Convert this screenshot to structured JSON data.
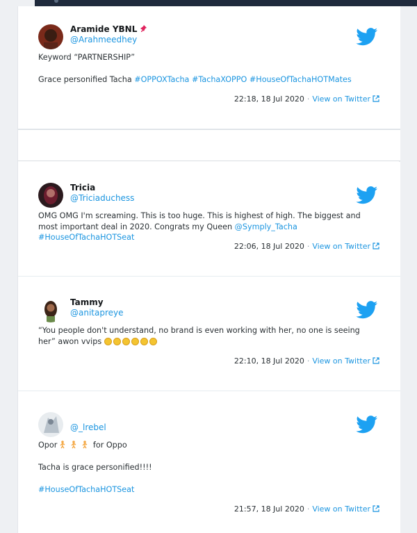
{
  "tweets": [
    {
      "name": "Aramide YBNL",
      "handle": "@Arahmeedhey",
      "line1": "Keyword “PARTNERSHIP”",
      "line2_prefix": "Grace personified Tacha ",
      "line2_tags": [
        "#OPPOXTacha",
        "#TachaXOPPO",
        "#HouseOfTachaHOTMates"
      ],
      "timestamp": "22:18, 18 Jul 2020",
      "view_label": "View on Twitter"
    },
    {
      "name": "Tricia",
      "handle": "@Triciaduchess",
      "text": "OMG OMG I'm screaming. This is too huge. This is highest of high. The biggest and most important deal in 2020. Congrats my Queen ",
      "mention": "@Symply_Tacha",
      "tag": "#HouseOfTachaHOTSeat",
      "timestamp": "22:06, 18 Jul 2020",
      "view_label": "View on Twitter"
    },
    {
      "name": "Tammy",
      "handle": "@anitapreye",
      "text": "“You people don't understand, no brand is even working with her, no one is seeing her” awon vvips",
      "emoji_count": 6,
      "timestamp": "22:10, 18 Jul 2020",
      "view_label": "View on Twitter"
    },
    {
      "name": "",
      "handle": "@_lrebel",
      "line1_prefix": "Opor",
      "line1_suffix": " for Oppo",
      "line2": "Tacha is grace personified!!!!",
      "tag": "#HouseOfTachaHOTSeat",
      "timestamp": "21:57, 18 Jul 2020",
      "view_label": "View on Twitter"
    }
  ],
  "icons": {
    "bird": "twitter-bird-icon",
    "pin": "pushpin-icon",
    "external": "external-link-icon"
  },
  "colors": {
    "link_blue": "#1b95e0",
    "bird_blue": "#1da1f2"
  }
}
